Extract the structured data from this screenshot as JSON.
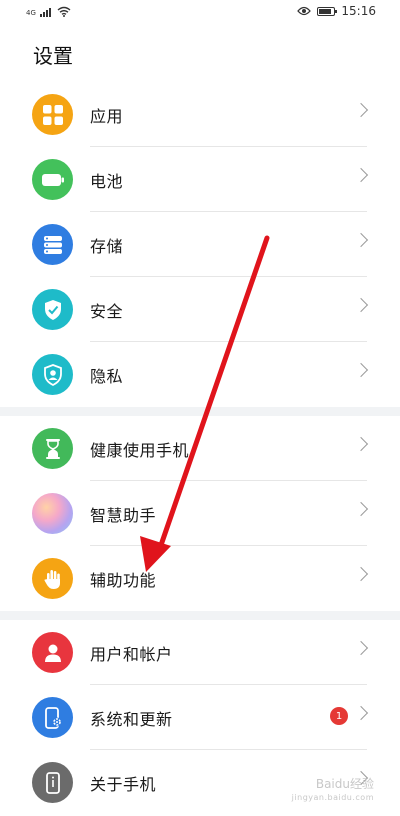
{
  "status_bar": {
    "network": "4G",
    "time": "15:16"
  },
  "page": {
    "title": "设置"
  },
  "colors": {
    "apps": "#f5a413",
    "battery": "#43c15b",
    "storage": "#2f7de1",
    "security": "#1ebbc9",
    "privacy": "#1ebbc9",
    "digital_balance": "#42b95a",
    "assistant": "#c9a1e3",
    "accessibility": "#f5a413",
    "users": "#e8353e",
    "system": "#2f7de1",
    "about": "#6b6b6b",
    "annotation_arrow": "#e0141c"
  },
  "sections": [
    {
      "items": [
        {
          "label": "应用",
          "icon": "grid-apps-icon"
        },
        {
          "label": "电池",
          "icon": "battery-icon"
        },
        {
          "label": "存储",
          "icon": "storage-icon"
        },
        {
          "label": "安全",
          "icon": "shield-check-icon"
        },
        {
          "label": "隐私",
          "icon": "privacy-shield-icon"
        }
      ]
    },
    {
      "items": [
        {
          "label": "健康使用手机",
          "icon": "hourglass-icon"
        },
        {
          "label": "智慧助手",
          "icon": "smart-assistant-icon"
        },
        {
          "label": "辅助功能",
          "icon": "hand-icon"
        }
      ]
    },
    {
      "items": [
        {
          "label": "用户和帐户",
          "icon": "user-icon"
        },
        {
          "label": "系统和更新",
          "icon": "phone-settings-icon",
          "badge": "1"
        },
        {
          "label": "关于手机",
          "icon": "phone-info-icon"
        }
      ]
    }
  ],
  "watermark": {
    "text": "Baidu经验",
    "url": "jingyan.baidu.com"
  }
}
